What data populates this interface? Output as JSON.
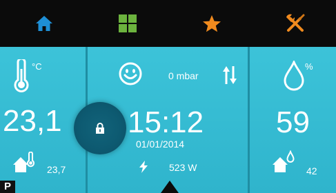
{
  "nav": {
    "items": [
      {
        "icon": "home-icon",
        "color": "#1e8fd6"
      },
      {
        "icon": "grid-icon",
        "color": "#6cb33e"
      },
      {
        "icon": "star-icon",
        "color": "#f08a1e"
      },
      {
        "icon": "tools-icon",
        "color": "#f08a1e"
      }
    ]
  },
  "left": {
    "temp_unit": "°C",
    "temperature": "23,1",
    "indoor_temp": "23,7"
  },
  "center": {
    "pressure": "0 mbar",
    "time": "15:12",
    "date": "01/01/2014",
    "power": "523 W"
  },
  "right": {
    "humidity_unit": "%",
    "humidity": "59",
    "indoor_humidity": "42"
  },
  "corner_label": "P",
  "colors": {
    "panel": "#3cc3d9",
    "topbar": "#0b0b0b",
    "lock": "#0d5a71"
  }
}
